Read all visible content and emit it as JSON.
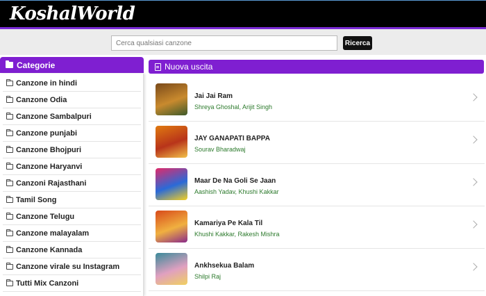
{
  "header": {
    "logo": "KoshalWorld"
  },
  "search": {
    "placeholder": "Cerca qualsiasi canzone",
    "button_label": "Ricerca"
  },
  "sidebar": {
    "title": "Categorie",
    "items": [
      "Canzone in hindi",
      "Canzone Odia",
      "Canzone Sambalpuri",
      "Canzone punjabi",
      "Canzone Bhojpuri",
      "Canzone Haryanvi",
      "Canzoni Rajasthani",
      "Tamil Song",
      "Canzone Telugu",
      "Canzone malayalam",
      "Canzone Kannada",
      "Canzone virale su Instagram",
      "Tutti Mix Canzoni"
    ]
  },
  "main": {
    "title": "Nuova uscita",
    "songs": [
      {
        "title": "Jai Jai Ram",
        "artist": "Shreya Ghoshal, Arijit Singh",
        "thumb_colors": [
          "#7a4a1a",
          "#c98a2e",
          "#3d5a2a"
        ]
      },
      {
        "title": "JAY GANAPATI BAPPA",
        "artist": "Sourav Bharadwaj",
        "thumb_colors": [
          "#e07a10",
          "#b8341a",
          "#f2c14a"
        ]
      },
      {
        "title": "Maar De Na Goli Se Jaan",
        "artist": "Aashish Yadav, Khushi Kakkar",
        "thumb_colors": [
          "#e02a6a",
          "#2a6ad8",
          "#f4d020"
        ]
      },
      {
        "title": "Kamariya Pe Kala Til",
        "artist": "Khushi Kakkar, Rakesh Mishra",
        "thumb_colors": [
          "#d84a1a",
          "#f0b040",
          "#8a2a8a"
        ]
      },
      {
        "title": "Ankhsekua Balam",
        "artist": "Shilpi Raj",
        "thumb_colors": [
          "#3a8a9a",
          "#e0a0c0",
          "#f0d060"
        ]
      }
    ]
  },
  "colors": {
    "accent": "#7f1fd1",
    "artist_green": "#2c7a2c"
  }
}
